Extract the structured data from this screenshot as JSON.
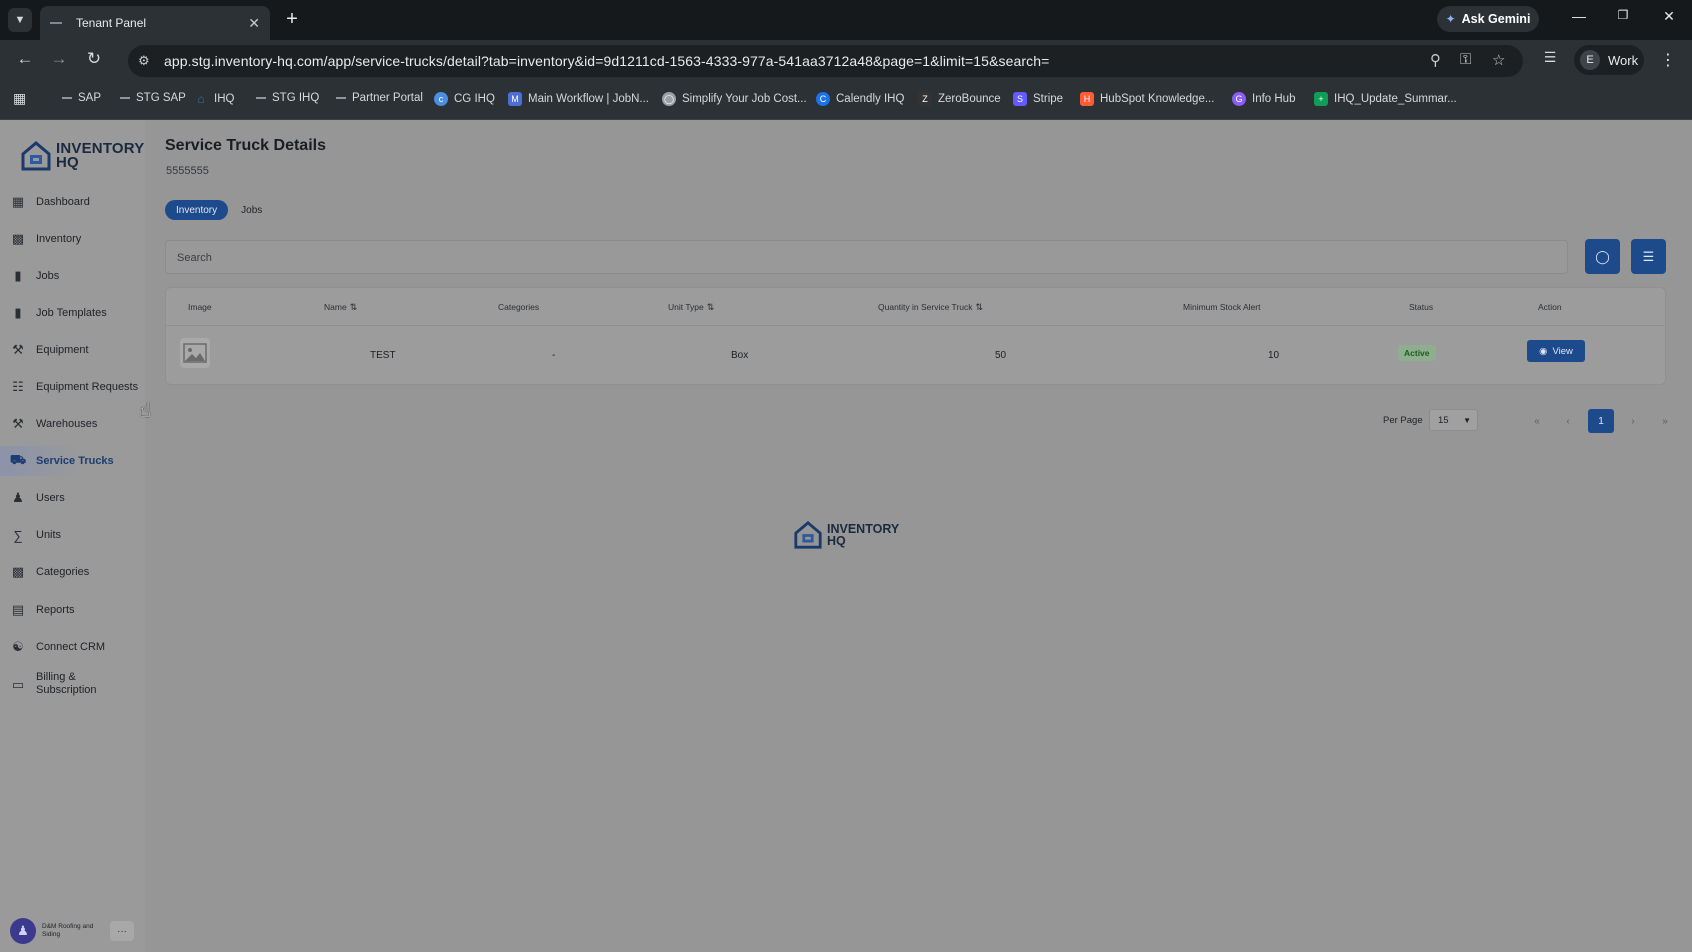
{
  "browser": {
    "tab_title": "Tenant Panel",
    "ask_gemini": "Ask Gemini",
    "url": "app.stg.inventory-hq.com/app/service-trucks/detail?tab=inventory&id=9d1211cd-1563-4333-977a-541aa3712a48&page=1&limit=15&search=",
    "profile_initial": "E",
    "profile_label": "Work",
    "bookmarks": [
      {
        "label": "SAP",
        "color": "#8a96a0"
      },
      {
        "label": "STG SAP",
        "color": "#8a96a0"
      },
      {
        "label": "IHQ",
        "color": "#3b6fb6"
      },
      {
        "label": "STG IHQ",
        "color": "#8a96a0"
      },
      {
        "label": "Partner Portal",
        "color": "#8a96a0"
      },
      {
        "label": "CG IHQ",
        "color": "#4a8fe0"
      },
      {
        "label": "Main Workflow | JobN...",
        "color": "#4c6fd6"
      },
      {
        "label": "Simplify Your Job Cost...",
        "color": "#9aa0a6"
      },
      {
        "label": "Calendly IHQ",
        "color": "#1a73e8"
      },
      {
        "label": "ZeroBounce",
        "color": "#333333"
      },
      {
        "label": "Stripe",
        "color": "#635bff"
      },
      {
        "label": "HubSpot Knowledge...",
        "color": "#ff5c35"
      },
      {
        "label": "Info Hub",
        "color": "#8b5cf6"
      },
      {
        "label": "IHQ_Update_Summar...",
        "color": "#0f9d58"
      }
    ]
  },
  "app": {
    "logo_line1": "INVENTORY",
    "logo_line2": "HQ",
    "nav": [
      {
        "label": "Dashboard",
        "icon": "dashboard-icon"
      },
      {
        "label": "Inventory",
        "icon": "inventory-icon"
      },
      {
        "label": "Jobs",
        "icon": "jobs-icon"
      },
      {
        "label": "Job Templates",
        "icon": "job-templates-icon"
      },
      {
        "label": "Equipment",
        "icon": "equipment-icon"
      },
      {
        "label": "Equipment Requests",
        "icon": "equipment-requests-icon"
      },
      {
        "label": "Warehouses",
        "icon": "warehouses-icon"
      },
      {
        "label": "Service Trucks",
        "icon": "truck-icon"
      },
      {
        "label": "Users",
        "icon": "users-icon"
      },
      {
        "label": "Units",
        "icon": "units-icon"
      },
      {
        "label": "Categories",
        "icon": "categories-icon"
      },
      {
        "label": "Reports",
        "icon": "reports-icon"
      },
      {
        "label": "Connect CRM",
        "icon": "crm-icon"
      },
      {
        "label": "Billing & Subscription",
        "icon": "billing-icon"
      }
    ],
    "user_name": "D&M Roofing and Siding",
    "user_more": "···"
  },
  "page": {
    "title": "Service Truck Details",
    "subtitle": "5555555",
    "tabs": [
      "Inventory",
      "Jobs"
    ],
    "search_placeholder": "Search",
    "columns": [
      "Image",
      "Name",
      "Categories",
      "Unit Type",
      "Quantity in Service Truck",
      "Minimum Stock Alert",
      "Status",
      "Action"
    ],
    "rows": [
      {
        "name": "TEST",
        "categories": "-",
        "unit_type": "Box",
        "quantity": "50",
        "min_stock": "10",
        "status": "Active",
        "action": "View"
      }
    ],
    "per_page_label": "Per Page",
    "per_page_value": "15",
    "pagination": {
      "first": "«",
      "prev": "‹",
      "current": "1",
      "next": "›",
      "last": "»"
    },
    "footer_logo_line1": "INVENTORY",
    "footer_logo_line2": "HQ"
  }
}
